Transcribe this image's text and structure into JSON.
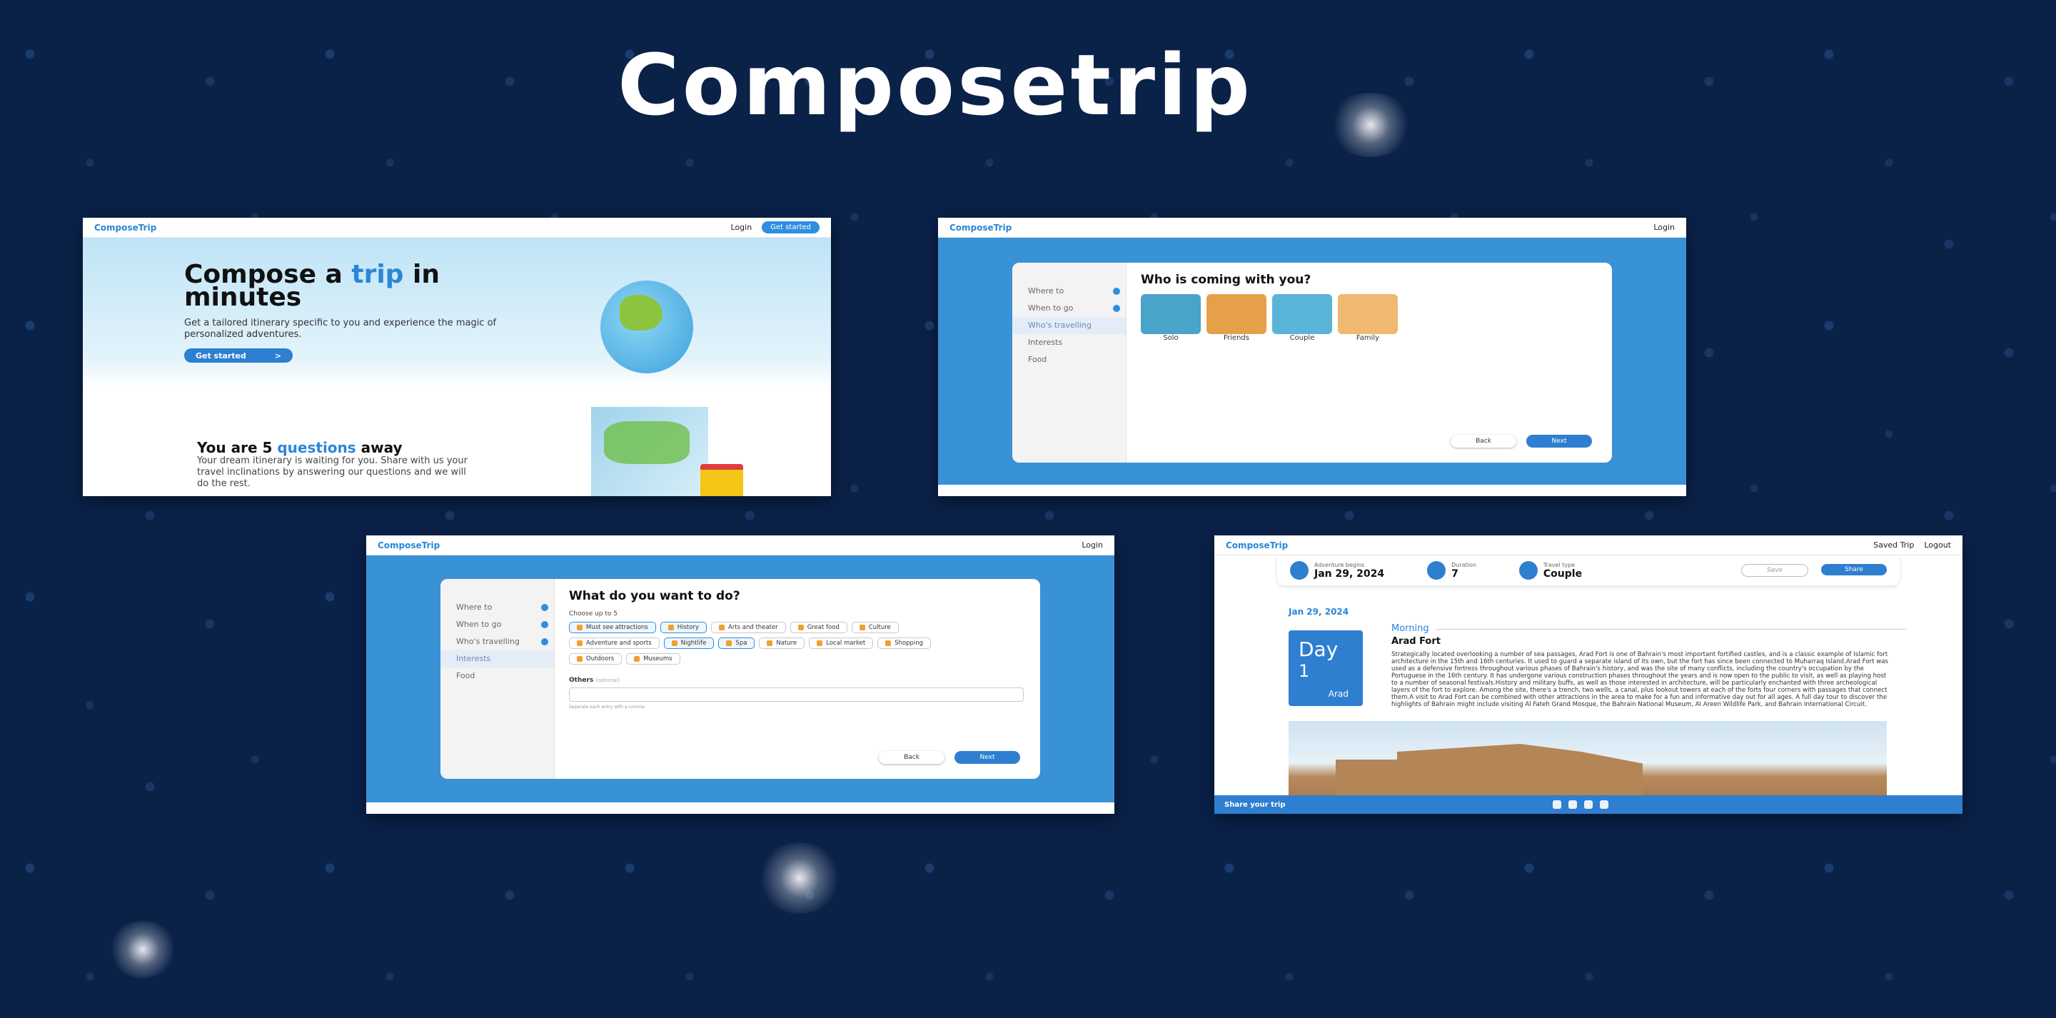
{
  "title": "Composetrip",
  "brand": "ComposeTrip",
  "shot1": {
    "nav": {
      "login": "Login",
      "get_started": "Get started"
    },
    "hero": {
      "title_part1": "Compose a ",
      "title_highlight": "trip",
      "title_part2": " in minutes",
      "subtitle": "Get a tailored itinerary specific to you and experience the magic of personalized adventures.",
      "button": "Get started",
      "button_arrow": ">"
    },
    "section": {
      "title_part1": "You are 5 ",
      "title_highlight": "questions",
      "title_part2": " away",
      "body": "Your dream itinerary is waiting for you. Share with us your travel inclinations by answering our questions and we will do the rest."
    }
  },
  "wizard_steps": [
    "Where to",
    "When to go",
    "Who's travelling",
    "Interests",
    "Food"
  ],
  "shot2": {
    "nav": {
      "login": "Login"
    },
    "question": "Who is coming with you?",
    "options": [
      {
        "label": "Solo",
        "color": "#4aa3c9"
      },
      {
        "label": "Friends",
        "color": "#e7a04a"
      },
      {
        "label": "Couple",
        "color": "#5ab4d8"
      },
      {
        "label": "Family",
        "color": "#f0b870"
      }
    ],
    "back": "Back",
    "next": "Next"
  },
  "shot3": {
    "nav": {
      "login": "Login"
    },
    "question": "What do you want to do?",
    "note": "Choose up to 5",
    "chips": [
      {
        "label": "Must see attractions",
        "selected": true
      },
      {
        "label": "History",
        "selected": true
      },
      {
        "label": "Arts and theater",
        "selected": false
      },
      {
        "label": "Great food",
        "selected": false
      },
      {
        "label": "Culture",
        "selected": false
      },
      {
        "label": "Adventure and sports",
        "selected": false
      },
      {
        "label": "Nightlife",
        "selected": true
      },
      {
        "label": "Spa",
        "selected": true
      },
      {
        "label": "Nature",
        "selected": false
      },
      {
        "label": "Local market",
        "selected": false
      },
      {
        "label": "Shopping",
        "selected": false
      },
      {
        "label": "Outdoors",
        "selected": false
      },
      {
        "label": "Museums",
        "selected": false
      }
    ],
    "others_label": "Others",
    "others_optional": "(optional)",
    "others_hint": "Separate each entry with a comma",
    "back": "Back",
    "next": "Next"
  },
  "shot4": {
    "nav": {
      "saved": "Saved Trip",
      "logout": "Logout"
    },
    "info": {
      "begins_label": "Adventure begins",
      "begins_value": "Jan 29, 2024",
      "duration_label": "Duration",
      "duration_value": "7",
      "type_label": "Travel type",
      "type_value": "Couple"
    },
    "save": "Save",
    "share": "Share",
    "date": "Jan 29, 2024",
    "day_label": "Day",
    "day_number": "1",
    "city": "Arad",
    "period": "Morning",
    "place": "Arad Fort",
    "description": "Strategically located overlooking a number of sea passages, Arad Fort is one of Bahrain's most important fortified castles, and is a classic example of Islamic fort architecture in the 15th and 16th centuries. It used to guard a separate island of its own, but the fort has since been connected to Muharraq Island.Arad Fort was used as a defensive fortress throughout various phases of Bahrain's history, and was the site of many conflicts, including the country's occupation by the Portuguese in the 16th century. It has undergone various construction phases throughout the years and is now open to the public to visit, as well as playing host to a number of seasonal festivals.History and military buffs, as well as those interested in architecture, will be particularly enchanted with three archeological layers of the fort to explore. Among the site, there's a trench, two wells, a canal, plus lookout towers at each of the forts four corners with passages that connect them.A visit to Arad Fort can be combined with other attractions in the area to make for a fun and informative day out for all ages. A full day tour to discover the highlights of Bahrain might include visiting Al Fateh Grand Mosque, the Bahrain National Museum, Al Areen Wildlife Park, and Bahrain International Circuit.",
    "share_bar": "Share your trip"
  }
}
